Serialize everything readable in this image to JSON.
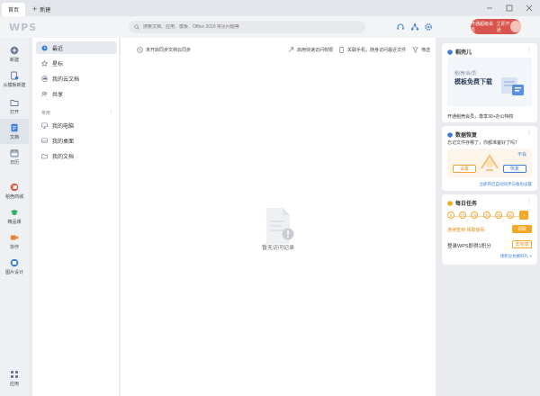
{
  "tabs": {
    "home": "首页",
    "new": "新建"
  },
  "header": {
    "logo": "WPS",
    "search_placeholder": "搜索文档、应用、模板、Office 2019 常见问题等",
    "vip_label": "开通超级会员",
    "vip_sub": "立即开通"
  },
  "leftbar": [
    {
      "label": "新建",
      "icon": "plus-circle-icon"
    },
    {
      "label": "从模板新建",
      "icon": "template-icon"
    },
    {
      "label": "打开",
      "icon": "folder-icon"
    },
    {
      "label": "文档",
      "icon": "document-icon"
    },
    {
      "label": "日历",
      "icon": "calendar-icon"
    },
    {
      "label": "稻壳商城",
      "icon": "docer-icon"
    },
    {
      "label": "精品课",
      "icon": "graduation-cap-icon"
    },
    {
      "label": "协作",
      "icon": "video-icon"
    },
    {
      "label": "图片设计",
      "icon": "image-design-icon"
    },
    {
      "label": "应用",
      "icon": "apps-grid-icon"
    }
  ],
  "nav": {
    "items": [
      {
        "label": "最近",
        "icon": "clock-icon"
      },
      {
        "label": "星标",
        "icon": "star-icon"
      },
      {
        "label": "我的云文档",
        "icon": "cloud-icon"
      },
      {
        "label": "共享",
        "icon": "share-users-icon"
      }
    ],
    "section_label": "常用",
    "section_action": "⋮",
    "quick": [
      {
        "label": "我的电脑",
        "icon": "computer-icon"
      },
      {
        "label": "我的桌面",
        "icon": "desktop-icon"
      },
      {
        "label": "我的文档",
        "icon": "my-docs-icon"
      }
    ]
  },
  "main": {
    "sync_text": "未开启同步文档云同步",
    "toolbar": [
      {
        "label": "启用快速访问权限",
        "icon": "quick-access-icon"
      },
      {
        "label": "关联手机，随身访问最近文件",
        "icon": "phone-icon"
      },
      {
        "label": "筛选",
        "icon": "filter-icon"
      }
    ],
    "empty_text": "暂无访问记录"
  },
  "cards": {
    "ad": {
      "title": "稻壳儿",
      "banner_top": "稻/壳/会/员",
      "banner_main": "模板免费下载",
      "caption": "开通稻壳会员，尊享30+办公特权"
    },
    "backup": {
      "title": "数据恢复",
      "question": "忘记文件存哪了，你都准备好了吗？",
      "badge": "不会",
      "btn_left": "设置",
      "btn_right": "恢复",
      "link": "立即开启自动同步与备份设置"
    },
    "task": {
      "title": "每日任务",
      "coins": [
        "5",
        "10",
        "15",
        "20",
        "25",
        "30",
        "?"
      ],
      "progress_text": "连续签到 领取惊喜",
      "claim_label": "领取",
      "desc": "登录WPS即得1积分",
      "goto_label": "去完成",
      "more_link": "领积分兑换好礼 >"
    }
  },
  "colors": {
    "accent": "#3b7dd8",
    "vip_red": "#d9544d",
    "task_orange": "#f5a623"
  }
}
